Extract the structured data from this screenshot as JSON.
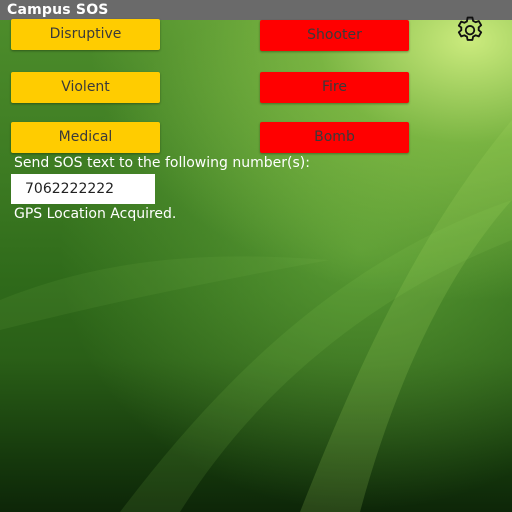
{
  "app": {
    "title": "Campus SOS"
  },
  "buttons": {
    "disruptive": "Disruptive",
    "shooter": "Shooter",
    "violent": "Violent",
    "fire": "Fire",
    "medical": "Medical",
    "bomb": "Bomb"
  },
  "settings": {
    "icon": "gear-icon"
  },
  "sos": {
    "prompt": "Send SOS text to the following number(s):",
    "phone_number": "7062222222"
  },
  "status": {
    "gps": "GPS Location Acquired."
  },
  "colors": {
    "yellow_button": "#ffcc00",
    "red_button": "#ff0000",
    "title_bar": "#6a6a6a"
  }
}
